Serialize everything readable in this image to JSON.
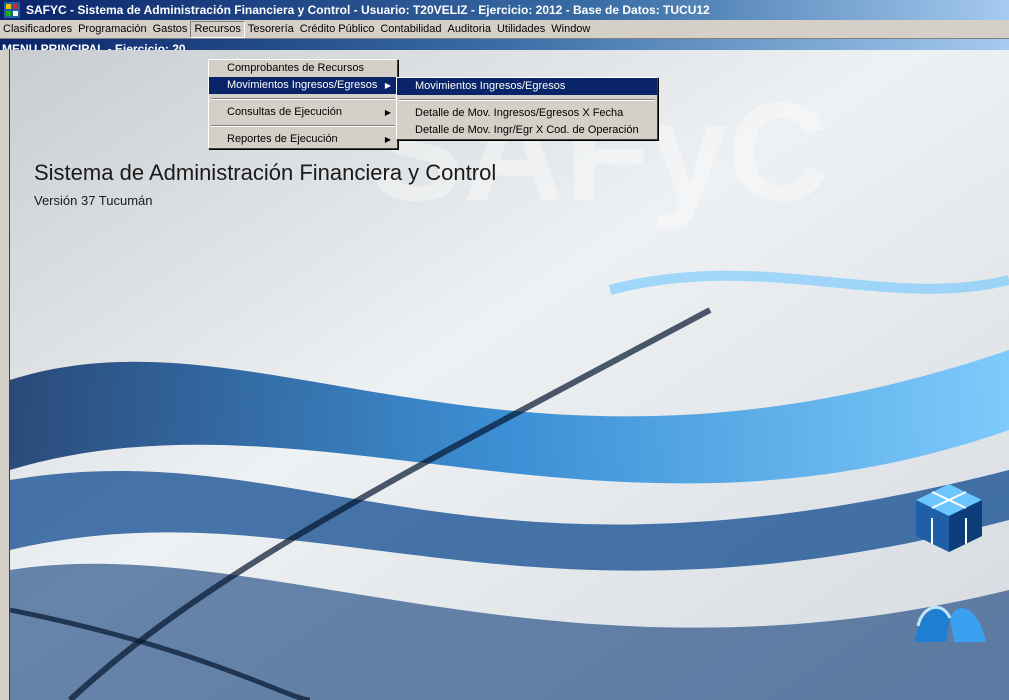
{
  "window": {
    "title": "SAFYC - Sistema de Administración Financiera y Control    - Usuario: T20VELIZ - Ejercicio: 2012 - Base de Datos: TUCU12"
  },
  "menubar": {
    "items": [
      "Clasificadores",
      "Programación",
      "Gastos",
      "Recursos",
      "Tesorería",
      "Crédito Público",
      "Contabilidad",
      "Auditoria",
      "Utilidades",
      "Window"
    ],
    "active": "Recursos"
  },
  "mdi": {
    "title": "MENU PRINCIPAL - Ejercicio: 20"
  },
  "recursos_menu": {
    "items": [
      "Comprobantes de Recursos",
      "Movimientos Ingresos/Egresos",
      "Consultas de Ejecución",
      "Reportes de Ejecución"
    ]
  },
  "submenu": {
    "items": [
      "Movimientos Ingresos/Egresos",
      "Detalle de Mov. Ingresos/Egresos X Fecha",
      "Detalle de Mov. Ingr/Egr X Cod. de Operación"
    ]
  },
  "main": {
    "heading": "Sistema de Administración Financiera y Control",
    "version": "Versión 37 Tucumán",
    "watermark": "SAFyC"
  }
}
